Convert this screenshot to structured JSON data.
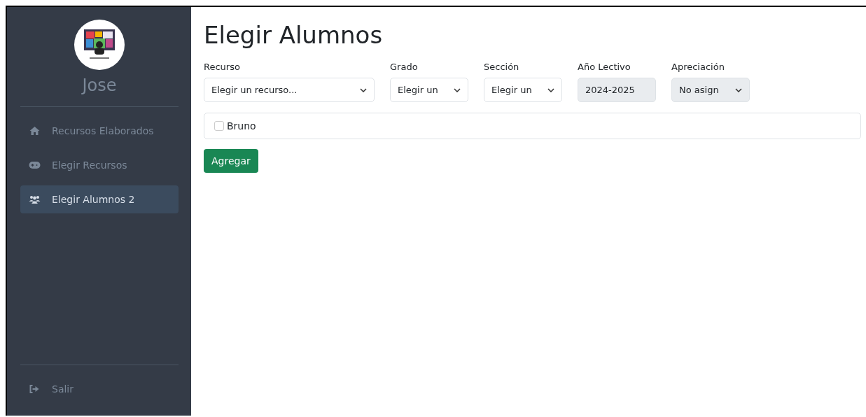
{
  "sidebar": {
    "user_name": "Jose",
    "items": [
      {
        "label": "Recursos Elaborados",
        "selected": false
      },
      {
        "label": "Elegir Recursos",
        "selected": false
      },
      {
        "label": "Elegir Alumnos 2",
        "selected": true
      }
    ],
    "footer_item": {
      "label": "Salir"
    }
  },
  "main": {
    "title": "Elegir Alumnos",
    "filters": [
      {
        "label": "Recurso",
        "value": "Elegir un recurso...",
        "kind": "select",
        "disabled": false
      },
      {
        "label": "Grado",
        "value": "Elegir un",
        "kind": "select",
        "disabled": false
      },
      {
        "label": "Sección",
        "value": "Elegir un",
        "kind": "select",
        "disabled": false
      },
      {
        "label": "Año Lectivo",
        "value": "2024-2025",
        "kind": "text",
        "disabled": true
      },
      {
        "label": "Apreciación",
        "value": "No asign",
        "kind": "select",
        "disabled": true
      }
    ],
    "students": [
      {
        "name": "Bruno",
        "checked": false
      }
    ],
    "button": "Agregar"
  }
}
